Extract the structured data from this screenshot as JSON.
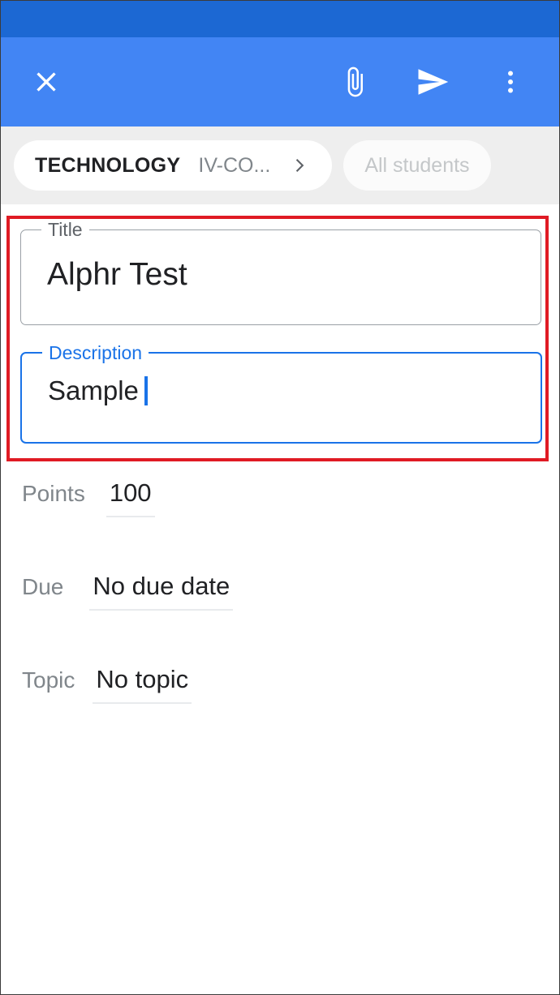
{
  "app": {
    "name": "Google Classroom",
    "screen": "New assignment"
  },
  "colors": {
    "status_bar": "#1c68d3",
    "app_bar": "#4285f4",
    "chip_strip_bg": "#eeeeee",
    "focus_blue": "#1a73e8",
    "annotation_red": "#e01b24",
    "label_gray": "#5f6368",
    "value_dark": "#202124",
    "underline_gray": "#e8eaed"
  },
  "app_bar": {
    "close_icon": "close-icon",
    "attach_icon": "paperclip-icon",
    "send_icon": "send-icon",
    "overflow_icon": "more-vert-icon"
  },
  "chips": {
    "course": {
      "name": "TECHNOLOGY",
      "section": "IV-CO...",
      "chevron_icon": "chevron-right-icon"
    },
    "students": {
      "label": "All students"
    }
  },
  "fields": {
    "title": {
      "label": "Title",
      "value": "Alphr Test",
      "focused": false
    },
    "description": {
      "label": "Description",
      "value": "Sample",
      "focused": true,
      "caret": true
    }
  },
  "meta_rows": [
    {
      "label": "Points",
      "value": "100"
    },
    {
      "label": "Due",
      "value": "No due date"
    },
    {
      "label": "Topic",
      "value": "No topic"
    }
  ]
}
